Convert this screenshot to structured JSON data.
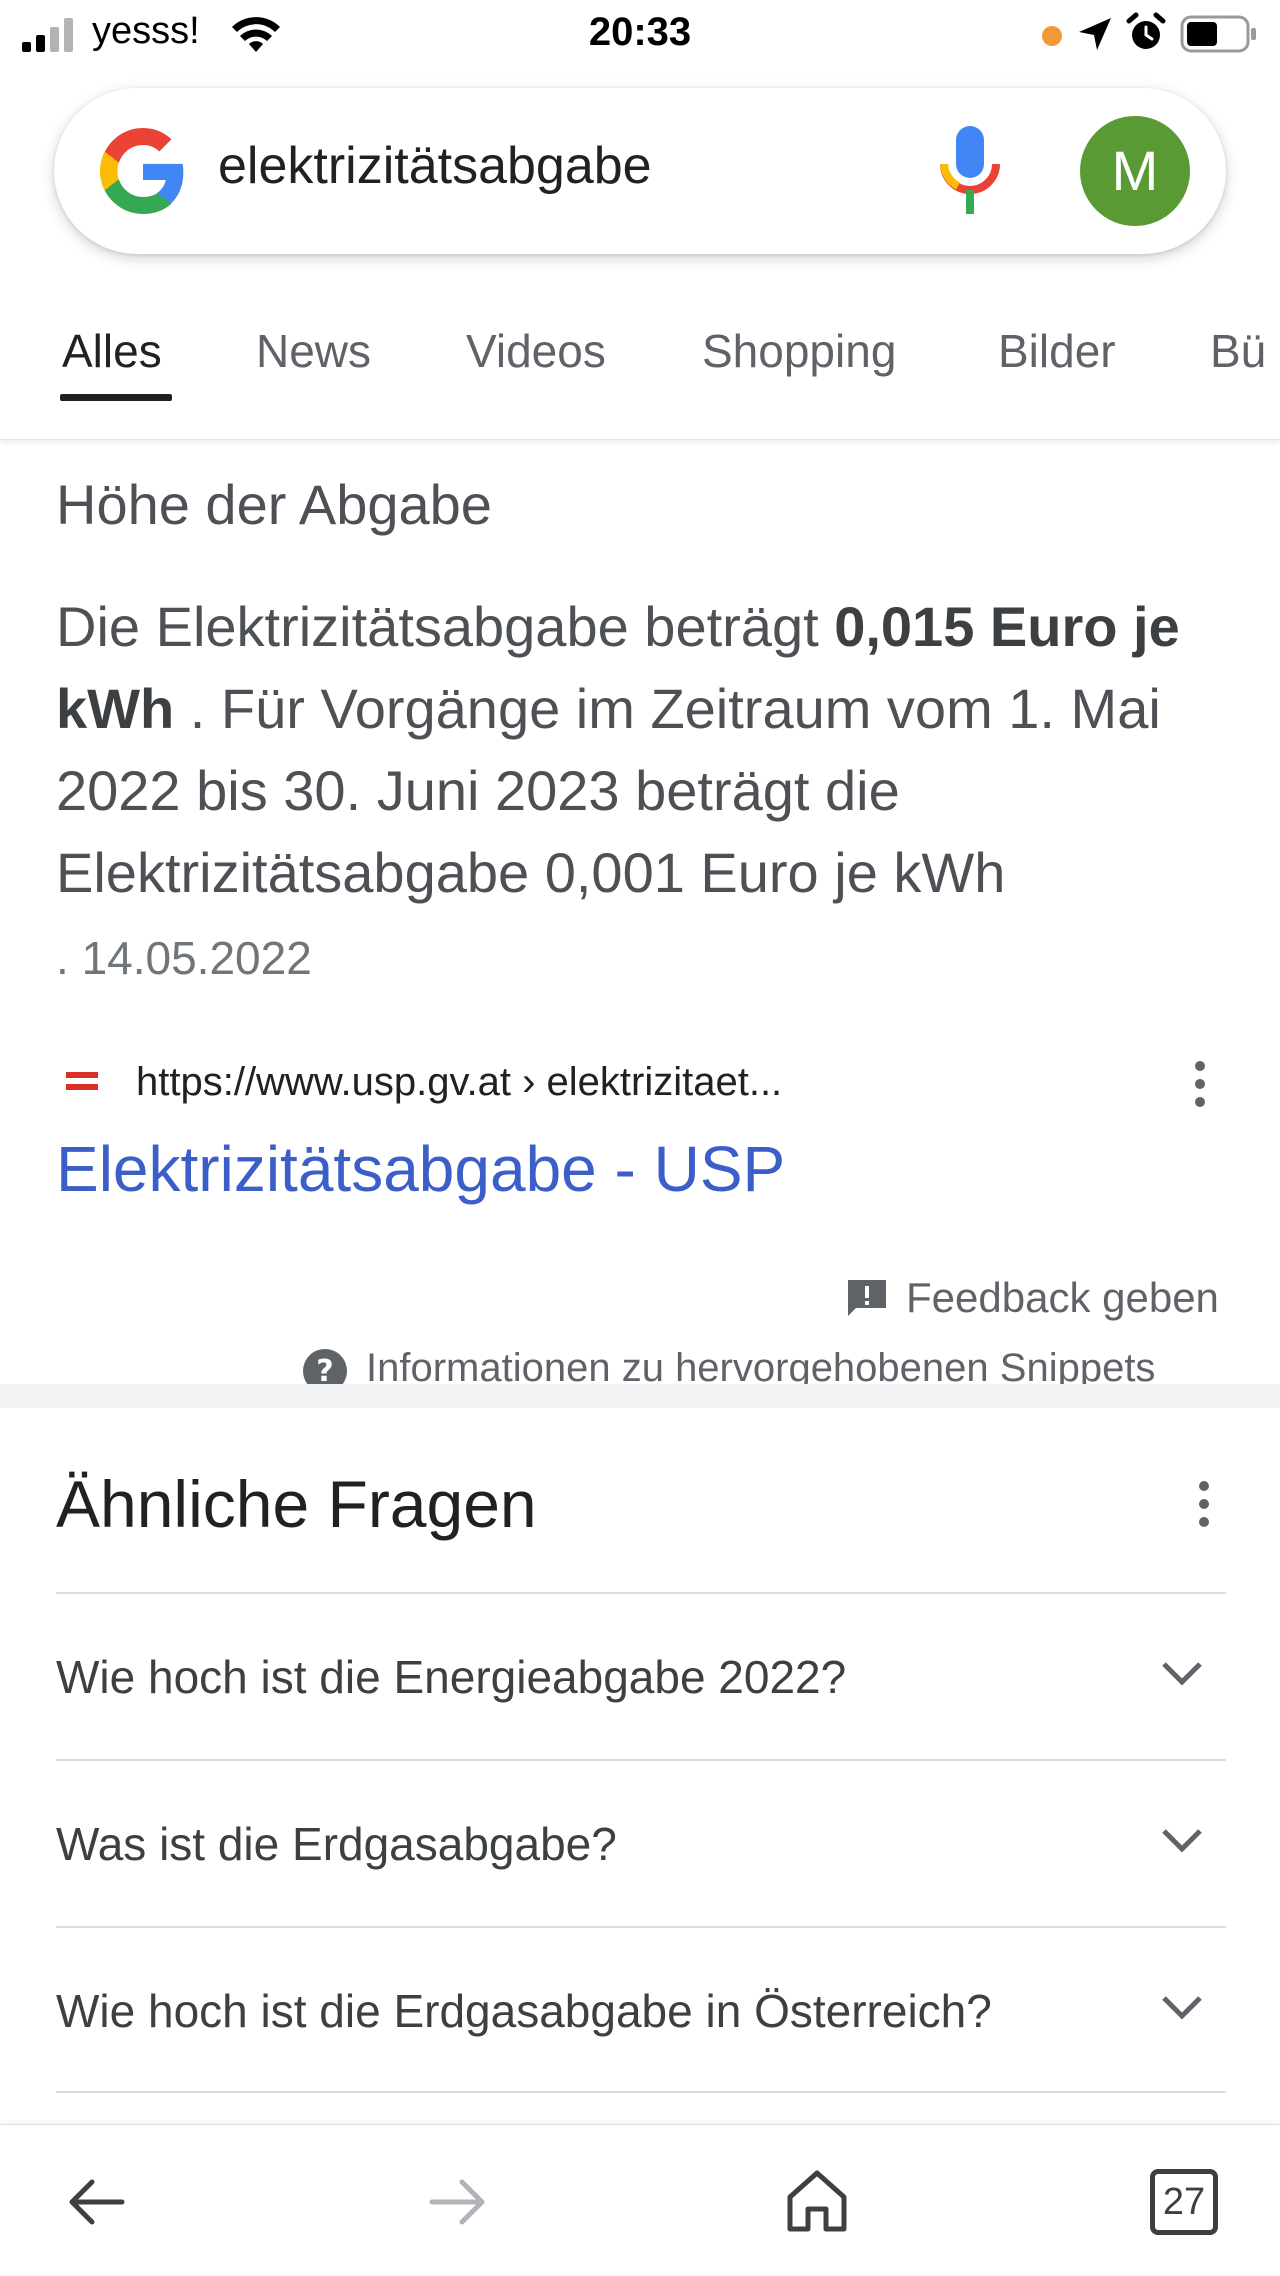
{
  "status_bar": {
    "carrier": "yesss!",
    "time": "20:33"
  },
  "search": {
    "query": "elektrizitätsabgabe",
    "avatar_letter": "M",
    "avatar_color": "#5a9a34"
  },
  "tabs": [
    {
      "label": "Alles",
      "active": true
    },
    {
      "label": "News"
    },
    {
      "label": "Videos"
    },
    {
      "label": "Shopping"
    },
    {
      "label": "Bilder"
    },
    {
      "label": "Bü"
    }
  ],
  "snippet": {
    "heading": "Höhe der Abgabe",
    "text_before": "Die Elektrizitätsabgabe beträgt ",
    "text_bold": "0,015 Euro je kWh",
    "text_after": " . Für Vorgänge im Zeitraum vom 1. Mai 2022 bis 30. Juni 2023 beträgt die Elektrizitätsabgabe 0,001 Euro je kWh",
    "date_prefix": ". ",
    "date": "14.05.2022",
    "source_url": "https://www.usp.gv.at › elektrizitaet...",
    "result_title": "Elektrizitätsabgabe - USP",
    "feedback": "Feedback geben",
    "info": "Informationen zu hervorgehobenen Snippets"
  },
  "related_questions": {
    "title": "Ähnliche Fragen",
    "items": [
      "Wie hoch ist die Energieabgabe 2022?",
      "Was ist die Erdgasabgabe?",
      "Wie hoch ist die Erdgasabgabe in Österreich?"
    ]
  },
  "toolbar": {
    "tab_count": "27"
  },
  "colors": {
    "link": "#3c5ec9",
    "camera_dot": "#f19a37"
  }
}
